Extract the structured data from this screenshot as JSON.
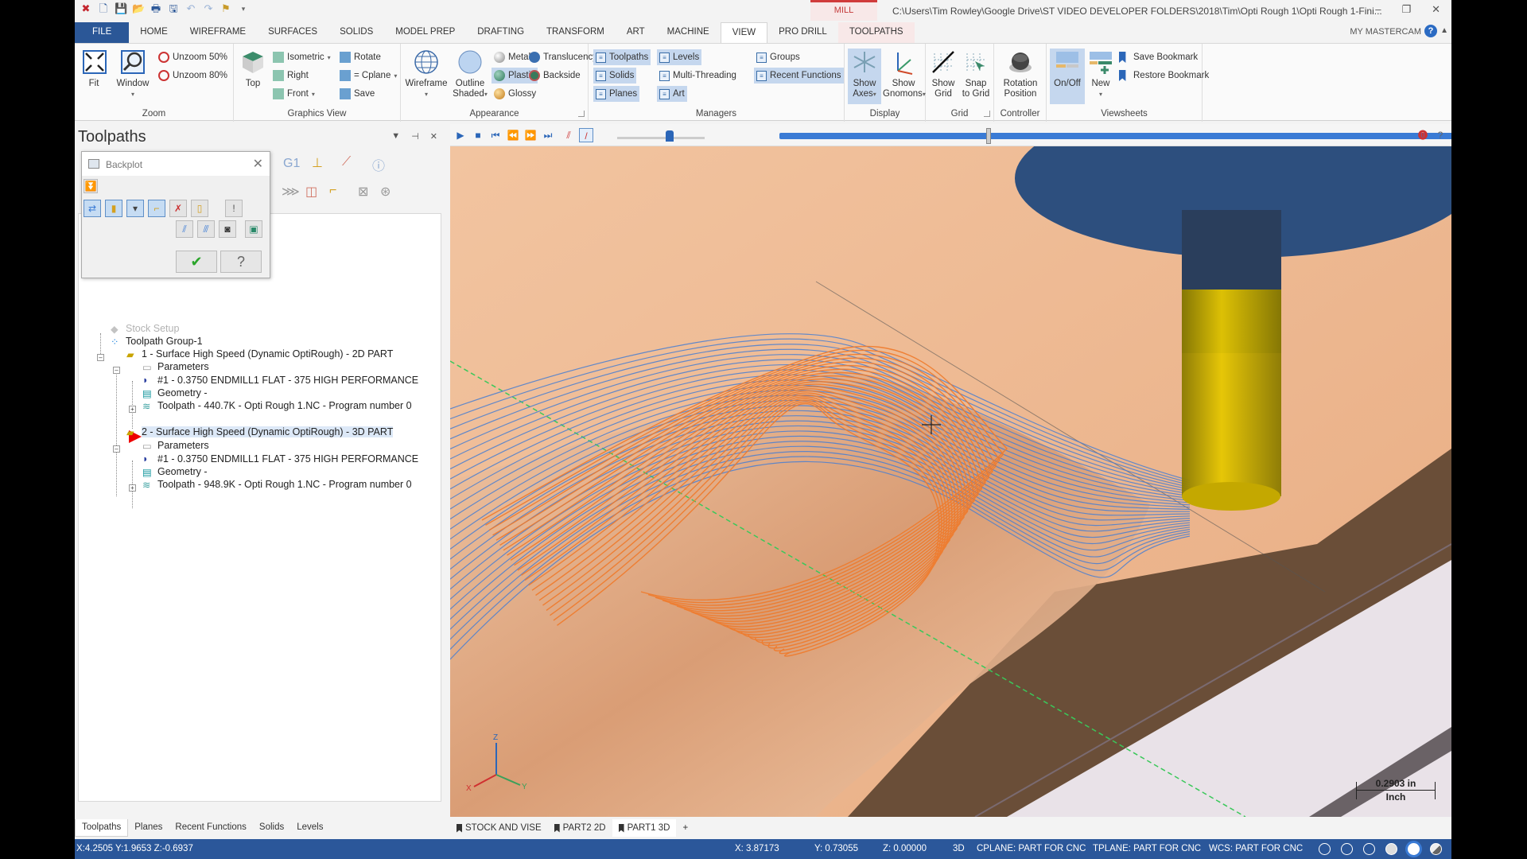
{
  "app": {
    "context_tab": "MILL",
    "window_title": "C:\\Users\\Tim Rowley\\Google Drive\\ST VIDEO DEVELOPER FOLDERS\\2018\\Tim\\Opti Rough 1\\Opti Rough 1-Fini...",
    "my_mastercam": "MY MASTERCAM"
  },
  "ribbon_tabs": [
    "FILE",
    "HOME",
    "WIREFRAME",
    "SURFACES",
    "SOLIDS",
    "MODEL PREP",
    "DRAFTING",
    "TRANSFORM",
    "ART",
    "MACHINE",
    "VIEW",
    "PRO DRILL",
    "TOOLPATHS"
  ],
  "active_tab": "VIEW",
  "ribbon": {
    "zoom": {
      "label": "Zoom",
      "fit": "Fit",
      "window": "Window",
      "unzoom50": "Unzoom 50%",
      "unzoom80": "Unzoom 80%"
    },
    "graphics_view": {
      "label": "Graphics View",
      "top": "Top",
      "isometric": "Isometric",
      "right": "Right",
      "front": "Front",
      "rotate": "Rotate",
      "cplane": "= Cplane",
      "save": "Save"
    },
    "appearance": {
      "label": "Appearance",
      "wireframe": "Wireframe",
      "outline_shaded_1": "Outline",
      "outline_shaded_2": "Shaded",
      "metallic": "Metallic",
      "plastic": "Plastic",
      "glossy": "Glossy",
      "translucency": "Translucency",
      "backside": "Backside"
    },
    "managers": {
      "label": "Managers",
      "toolpaths": "Toolpaths",
      "solids": "Solids",
      "planes": "Planes",
      "levels": "Levels",
      "multi_threading": "Multi-Threading",
      "art": "Art",
      "groups": "Groups",
      "recent_functions": "Recent Functions"
    },
    "display": {
      "label": "Display",
      "show_axes_1": "Show",
      "show_axes_2": "Axes",
      "show_gnomons_1": "Show",
      "show_gnomons_2": "Gnomons"
    },
    "grid": {
      "label": "Grid",
      "show_grid_1": "Show",
      "show_grid_2": "Grid",
      "snap_1": "Snap",
      "snap_2": "to Grid"
    },
    "controller": {
      "label": "Controller",
      "rotation_1": "Rotation",
      "rotation_2": "Position"
    },
    "viewsheets": {
      "label": "Viewsheets",
      "onoff": "On/Off",
      "new": "New",
      "save_bookmark": "Save Bookmark",
      "restore_bookmark": "Restore Bookmark"
    }
  },
  "panel": {
    "title": "Toolpaths",
    "backplot": {
      "title": "Backplot"
    },
    "tree": [
      {
        "label": "Stock Setup",
        "level": 1
      },
      {
        "label": "Toolpath Group-1",
        "level": 1
      },
      {
        "label": "1 - Surface High Speed (Dynamic OptiRough) - 2D PART",
        "level": 2
      },
      {
        "label": "Parameters",
        "level": 3
      },
      {
        "label": "#1 - 0.3750 ENDMILL1 FLAT - 375 HIGH PERFORMANCE",
        "level": 3
      },
      {
        "label": "Geometry -",
        "level": 3
      },
      {
        "label": "Toolpath - 440.7K - Opti Rough 1.NC - Program number 0",
        "level": 3
      },
      {
        "label": "2 - Surface High Speed (Dynamic OptiRough) - 3D PART",
        "level": 2,
        "selected": true
      },
      {
        "label": "Parameters",
        "level": 3
      },
      {
        "label": "#1 - 0.3750 ENDMILL1 FLAT - 375 HIGH PERFORMANCE",
        "level": 3
      },
      {
        "label": "Geometry -",
        "level": 3
      },
      {
        "label": "Toolpath - 948.9K - Opti Rough 1.NC - Program number 0",
        "level": 3
      }
    ],
    "bottom_tabs": [
      "Toolpaths",
      "Planes",
      "Recent Functions",
      "Solids",
      "Levels"
    ],
    "active_bottom_tab": "Toolpaths"
  },
  "playback": {
    "progress_fraction": 0.3,
    "speed_fraction": 0.6
  },
  "viewport": {
    "scale_value": "0.2903 in",
    "scale_unit": "Inch",
    "colors": {
      "stock": "#e8b08a",
      "stock_shadow": "#6a4e38",
      "toolpath_orange": "#f07a2a",
      "toolpath_blue": "#4a7fd1",
      "holder": "#2d4f7e",
      "tool": "#d4b200"
    }
  },
  "viewsheets": [
    "STOCK AND VISE",
    "PART2 2D",
    "PART1 3D"
  ],
  "active_viewsheet": "PART1 3D",
  "add_sheet": "+",
  "status": {
    "cursor": "X:4.2505   Y:1.9653   Z:-0.6937",
    "x": "X:  3.87173",
    "y": "Y:  0.73055",
    "z": "Z:  0.00000",
    "mode": "3D",
    "cplane": "CPLANE: PART FOR CNC",
    "tplane": "TPLANE: PART FOR CNC",
    "wcs": "WCS: PART FOR CNC"
  }
}
